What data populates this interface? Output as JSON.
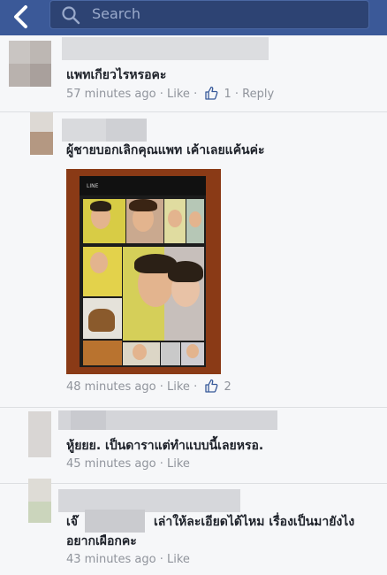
{
  "header": {
    "search_placeholder": "Search"
  },
  "comments": [
    {
      "text": "แพทเกียวไรหรอคะ",
      "time": "57 minutes ago",
      "like": "Like",
      "likes": "1",
      "reply": "Reply"
    },
    {
      "text": "ผู้ชายบอกเลิกคุณแพท เค้าเลยแค้นค่ะ",
      "time": "48 minutes ago",
      "like": "Like",
      "likes": "2",
      "photo_topbar": "LINE"
    },
    {
      "text": "หู้ยยย. เป็นดาราแต่ทำแบบนี้เลยหรอ.",
      "time": "45 minutes ago",
      "like": "Like"
    },
    {
      "text_prefix": "เจ๊",
      "text": "เล่าให้ละเอียดได้ไหม เรื่องเป็นมายังไง อยากเผือกคะ",
      "time": "43 minutes ago",
      "like": "Like"
    }
  ],
  "colors": {
    "header": "#3b5998",
    "meta": "#90949c",
    "link": "#90949c",
    "background": "#f6f7f9"
  },
  "icons": [
    "back-chevron-icon",
    "search-icon",
    "thumbs-up-icon"
  ]
}
